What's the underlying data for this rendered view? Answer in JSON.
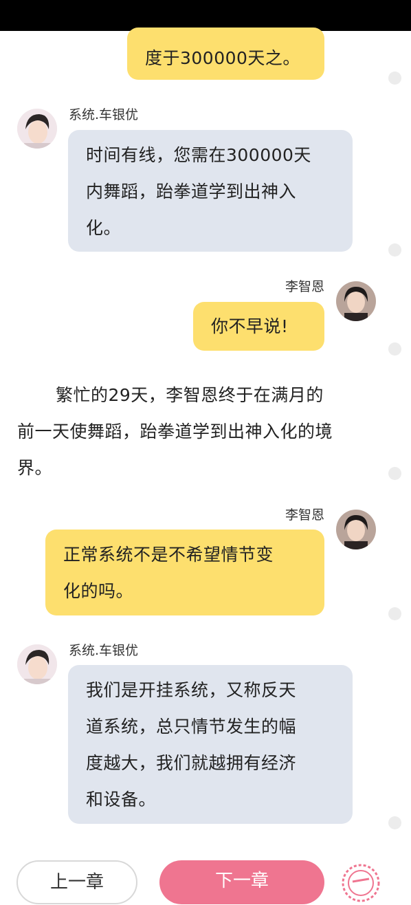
{
  "chat": {
    "partial_top_message": "度于300000天之。",
    "messages": [
      {
        "sender": "系统.车银优",
        "text_lines": [
          "时间有线，您需在300000天",
          "内舞蹈，跆拳道学到出神入",
          "化。"
        ]
      },
      {
        "sender": "李智恩",
        "text_lines": [
          "你不早说!"
        ]
      },
      {
        "sender": "李智恩",
        "text_lines": [
          "正常系统不是不希望情节变",
          "化的吗。"
        ]
      },
      {
        "sender": "系统.车银优",
        "text_lines": [
          "我们是开挂系统，又称反天",
          "道系统，总只情节发生的幅",
          "度越大，我们就越拥有经济",
          "和设备。"
        ]
      }
    ]
  },
  "narration": {
    "lines": [
      "繁忙的29天，李智恩终于在满月的",
      "前一天使舞蹈，跆拳道学到出神入化的境",
      "界。"
    ]
  },
  "footer": {
    "prev_label": "上一章",
    "next_label": "下一章",
    "checkin_icon": "sign-in-stamp-icon"
  },
  "colors": {
    "my_bubble": "#fddf6e",
    "system_bubble": "#e0e5ee",
    "next_button": "#ef7590"
  }
}
